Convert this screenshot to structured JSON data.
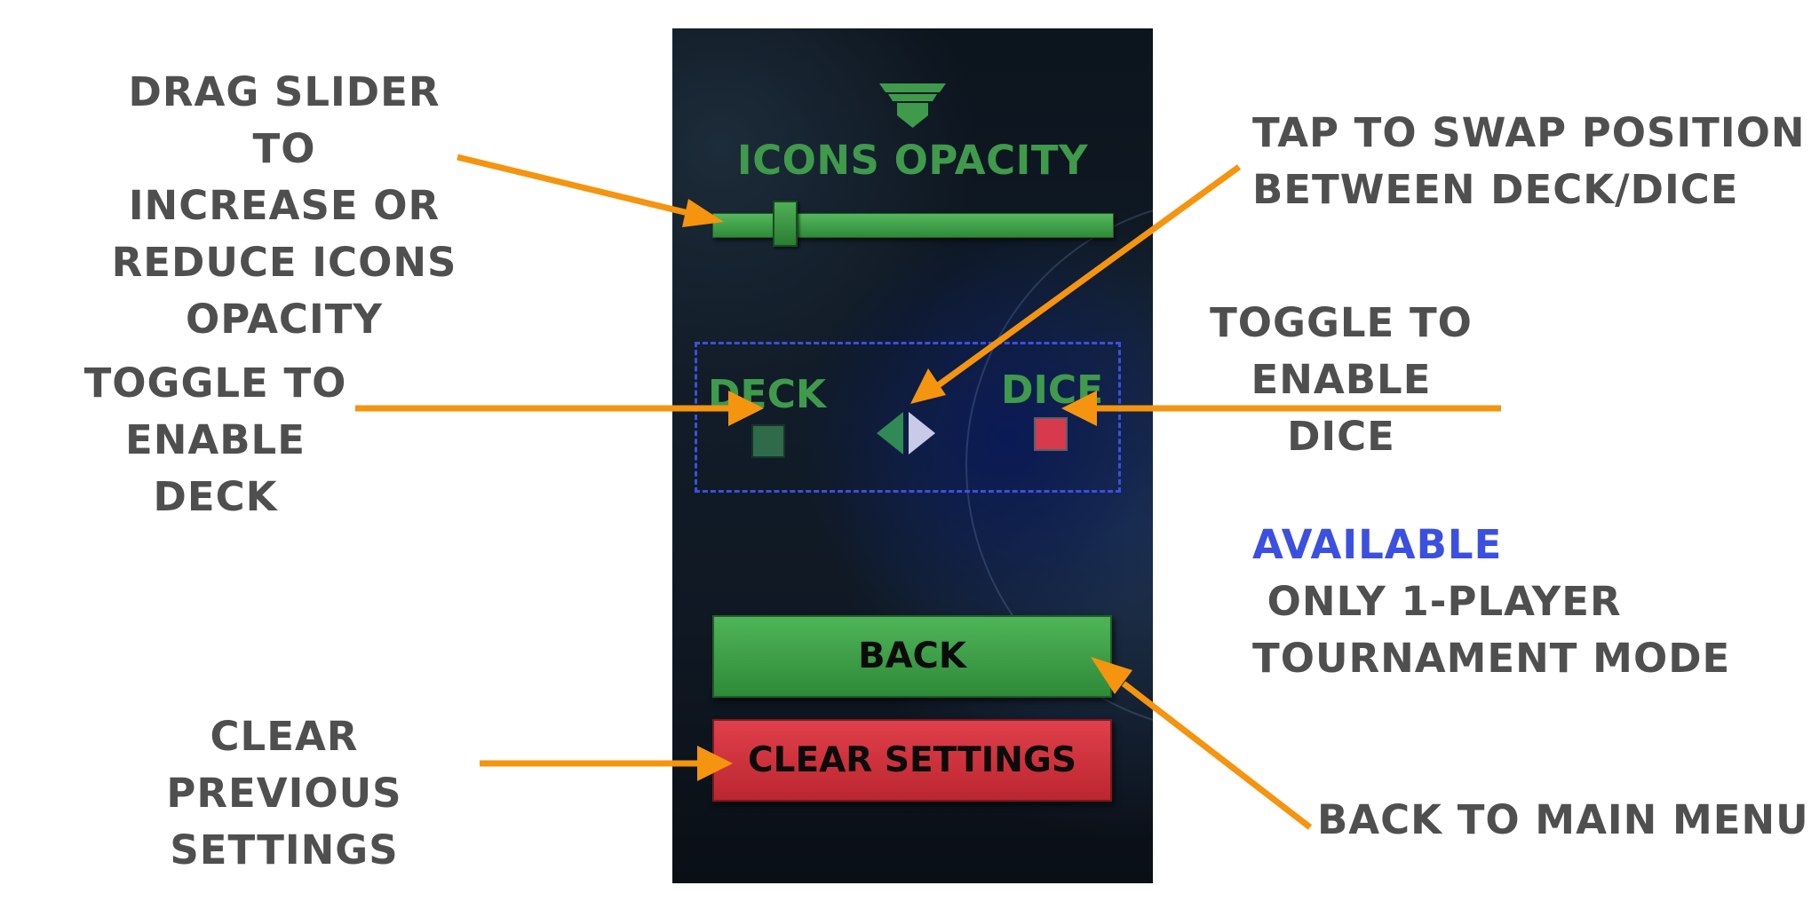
{
  "annotations": {
    "slider_lines": [
      "DRAG SLIDER TO",
      "INCREASE OR",
      "REDUCE ICONS",
      "OPACITY"
    ],
    "swap_lines": [
      "TAP TO SWAP POSITION",
      "BETWEEN DECK/DICE"
    ],
    "deck_lines": [
      "TOGGLE TO",
      "ENABLE DECK"
    ],
    "dice_lines": [
      "TOGGLE TO",
      "ENABLE DICE"
    ],
    "available_highlight": "AVAILABLE",
    "available_rest": " ONLY 1-PLAYER",
    "available_line2": "TOURNAMENT MODE",
    "clear_lines": [
      "CLEAR PREVIOUS",
      "SETTINGS"
    ],
    "back_note": "BACK TO MAIN MENU"
  },
  "screen": {
    "title": "ICONS OPACITY",
    "opacity_slider_value": 0.1,
    "deck_label": "DECK",
    "dice_label": "DICE",
    "back_button": "BACK",
    "clear_button": "CLEAR SETTINGS"
  },
  "colors": {
    "annotation_text": "#4f4f4f",
    "highlight": "#3b4fe0",
    "arrow": "#f5940f",
    "accent_green": "#3f9a4c",
    "dice_toggle": "#d63a4c",
    "deck_toggle": "#2f6a4a"
  },
  "icons": [
    "shield-logo-icon",
    "swap-arrows-icon"
  ]
}
